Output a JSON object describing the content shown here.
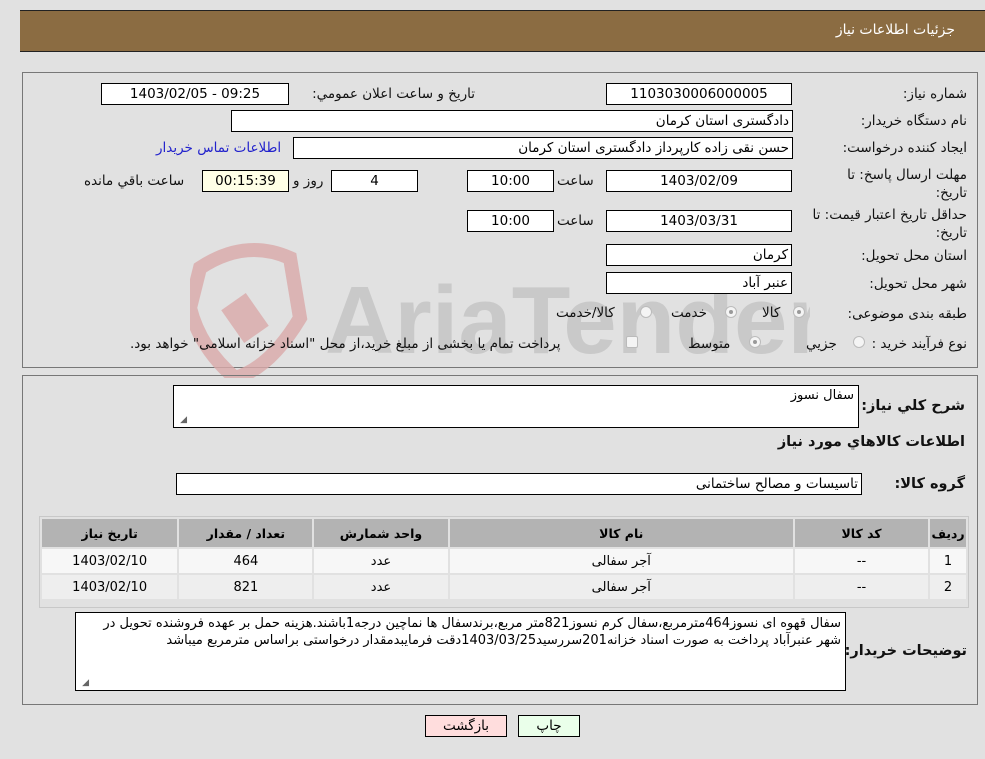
{
  "header": {
    "title": "جزئیات اطلاعات نیاز"
  },
  "form": {
    "need_number_label": "شماره نیاز:",
    "need_number": "1103030006000005",
    "announce_label": "تاریخ و ساعت اعلان عمومي:",
    "announce_value": "1403/02/05 - 09:25",
    "buyer_org_label": "نام دستگاه خریدار:",
    "buyer_org": "دادگستری استان کرمان",
    "creator_label": "ایجاد کننده درخواست:",
    "creator": "حسن نقی زاده کارپرداز دادگستری استان کرمان",
    "contact_link": "اطلاعات تماس خریدار",
    "deadline_label": "مهلت ارسال پاسخ: تا تاریخ:",
    "deadline_date": "1403/02/09",
    "time_label": "ساعت",
    "deadline_time": "10:00",
    "days_remaining": "4",
    "days_label": "روز و",
    "time_remaining": "00:15:39",
    "time_remaining_label": "ساعت باقي مانده",
    "price_validity_label": "حداقل تاریخ اعتبار قیمت: تا تاریخ:",
    "price_validity_date": "1403/03/31",
    "price_validity_time": "10:00",
    "province_label": "استان محل تحویل:",
    "province": "کرمان",
    "city_label": "شهر محل تحویل:",
    "city": "عنبر آباد",
    "category_label": "طبقه بندی موضوعی:",
    "category_options": [
      "کالا",
      "خدمت",
      "کالا/خدمت"
    ],
    "process_label": "نوع فرآیند خرید :",
    "process_options": [
      "جزيي",
      "متوسط"
    ],
    "payment_note": "پرداخت تمام یا بخشی از مبلغ خرید،از محل \"اسناد خزانه اسلامی\" خواهد بود."
  },
  "details": {
    "summary_label": "شرح کلي نياز:",
    "summary": "سفال نسوز",
    "goods_heading": "اطلاعات کالاهاي مورد نياز",
    "group_label": "گروه کالا:",
    "group": "تاسیسات و مصالح ساختمانی",
    "table": {
      "headers": [
        "رديف",
        "کد کالا",
        "نام کالا",
        "واحد شمارش",
        "تعداد / مقدار",
        "تاريخ نياز"
      ],
      "rows": [
        [
          "1",
          "--",
          "آجر سفالی",
          "عدد",
          "464",
          "1403/02/10"
        ],
        [
          "2",
          "--",
          "آجر سفالی",
          "عدد",
          "821",
          "1403/02/10"
        ]
      ]
    },
    "buyer_notes_label": "توضیحات خریدار:",
    "buyer_notes": "سفال قهوه ای نسوز464مترمربع،سفال کرم نسوز821متر مربع،برندسفال ها نماچین درجه1باشند.هزینه حمل بر عهده فروشنده تحویل در شهر عنبرآباد پرداخت به صورت اسناد خزانه201سررسید1403/03/25دقت فرمایبدمقدار درخواستی براساس مترمربع میباشد"
  },
  "buttons": {
    "print": "چاپ",
    "back": "بازگشت"
  },
  "watermark": {
    "text": "AriaTender.neT"
  }
}
